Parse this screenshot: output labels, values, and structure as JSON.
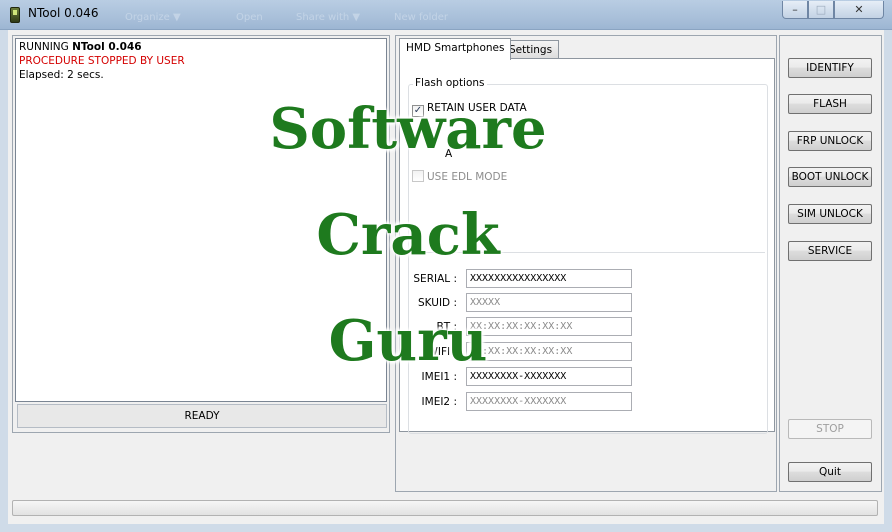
{
  "window": {
    "title": "NTool 0.046",
    "ghost_menu": [
      "Organize ▼",
      "Open",
      "Share with ▼",
      "New folder"
    ],
    "controls": {
      "minimize": "–",
      "maximize": "□",
      "close": "✕"
    }
  },
  "log": {
    "line1_prefix": "RUNNING ",
    "line1_bold": "NTool 0.046",
    "line2": "PROCEDURE STOPPED BY USER",
    "line3": "Elapsed: 2 secs."
  },
  "status": "READY",
  "tabs": [
    {
      "label": "HMD Smartphones",
      "active": true
    },
    {
      "label": "Settings",
      "active": false
    }
  ],
  "flash_options": {
    "label": "Flash options",
    "retain_user_data": {
      "label": "RETAIN USER DATA",
      "checked": true
    },
    "hidden_option": {
      "label": "A"
    },
    "use_edl_mode": {
      "label": "USE EDL MODE",
      "checked": false,
      "enabled": false
    }
  },
  "fields": [
    {
      "label": "SERIAL :",
      "value": "XXXXXXXXXXXXXXXX",
      "placeholder": ""
    },
    {
      "label": "SKUID :",
      "value": "",
      "placeholder": "XXXXX"
    },
    {
      "label": "BT :",
      "value": "",
      "placeholder": "XX:XX:XX:XX:XX:XX"
    },
    {
      "label": "WIFI :",
      "value": "",
      "placeholder": "XX:XX:XX:XX:XX:XX"
    },
    {
      "label": "IMEI1 :",
      "value": "XXXXXXXX-XXXXXXX",
      "placeholder": ""
    },
    {
      "label": "IMEI2 :",
      "value": "",
      "placeholder": "XXXXXXXX-XXXXXXX"
    }
  ],
  "buttons": {
    "identify": "IDENTIFY",
    "flash": "FLASH",
    "frp_unlock": "FRP UNLOCK",
    "boot_unlock": "BOOT UNLOCK",
    "sim_unlock": "SIM UNLOCK",
    "service": "SERVICE",
    "stop": "STOP",
    "quit": "Quit"
  },
  "progress": 0,
  "watermark": [
    "Software",
    "Crack",
    "Guru"
  ],
  "colors": {
    "watermark": "#1e7a1e",
    "log_error": "#d40000",
    "titlebar": "#a9c0da"
  }
}
